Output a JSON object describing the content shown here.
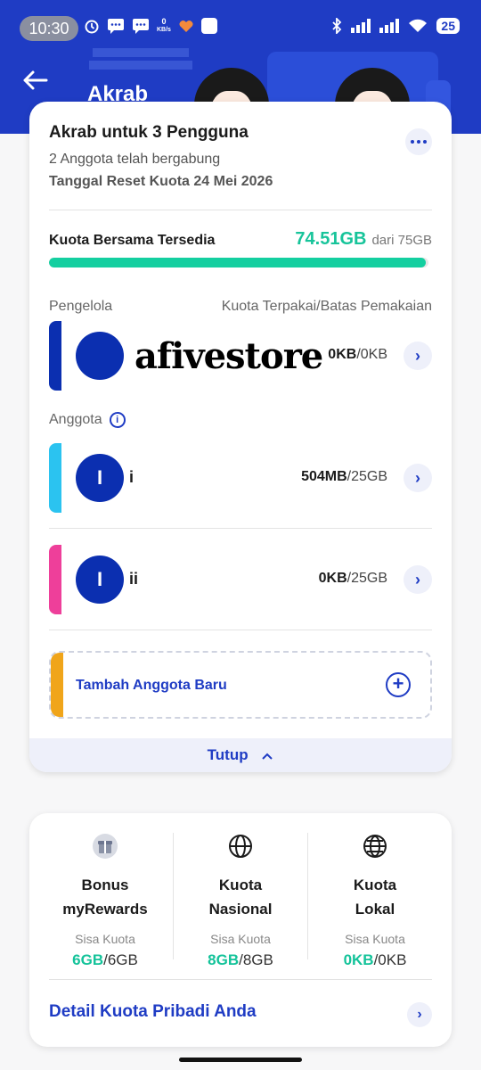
{
  "status_bar": {
    "time": "10:30",
    "net_speed": "0",
    "net_unit": "KB/s",
    "battery": "25"
  },
  "header": {
    "title": "Akrab"
  },
  "plan": {
    "title": "Akrab untuk 3 Pengguna",
    "members_joined": "2 Anggota telah bergabung",
    "reset_date": "Tanggal Reset Kuota 24 Mei 2026"
  },
  "shared_quota": {
    "label": "Kuota Bersama Tersedia",
    "available": "74.51GB",
    "total": "dari 75GB",
    "available_fraction": 0.9935
  },
  "columns": {
    "manager": "Pengelola",
    "usage": "Kuota Terpakai/Batas Pemakaian"
  },
  "manager": {
    "watermark": "afivestore",
    "used": "0KB",
    "limit": "/0KB",
    "strip_color": "#0b2fb0"
  },
  "members_section": {
    "label": "Anggota"
  },
  "members": [
    {
      "initial": "I",
      "name": "i",
      "used": "504MB",
      "limit": "/25GB",
      "strip_color": "#2bc3f0"
    },
    {
      "initial": "I",
      "name": "ii",
      "used": "0KB",
      "limit": "/25GB",
      "strip_color": "#ee3f9a"
    }
  ],
  "add_member": {
    "label": "Tambah Anggota Baru",
    "strip_color": "#f0a51a"
  },
  "close_label": "Tutup",
  "personal_quota": [
    {
      "icon": "gift-icon",
      "title_line1": "Bonus",
      "title_line2": "myRewards",
      "sub": "Sisa Kuota",
      "remaining": "6GB",
      "total": "/6GB"
    },
    {
      "icon": "globe-icon",
      "title_line1": "Kuota",
      "title_line2": "Nasional",
      "sub": "Sisa Kuota",
      "remaining": "8GB",
      "total": "/8GB"
    },
    {
      "icon": "globe-icon",
      "title_line1": "Kuota",
      "title_line2": "Lokal",
      "sub": "Sisa Kuota",
      "remaining": "0KB",
      "total": "/0KB"
    }
  ],
  "detail_link": "Detail Kuota Pribadi Anda",
  "colors": {
    "brand": "#1f3cc4",
    "accent_green": "#14c39a"
  }
}
